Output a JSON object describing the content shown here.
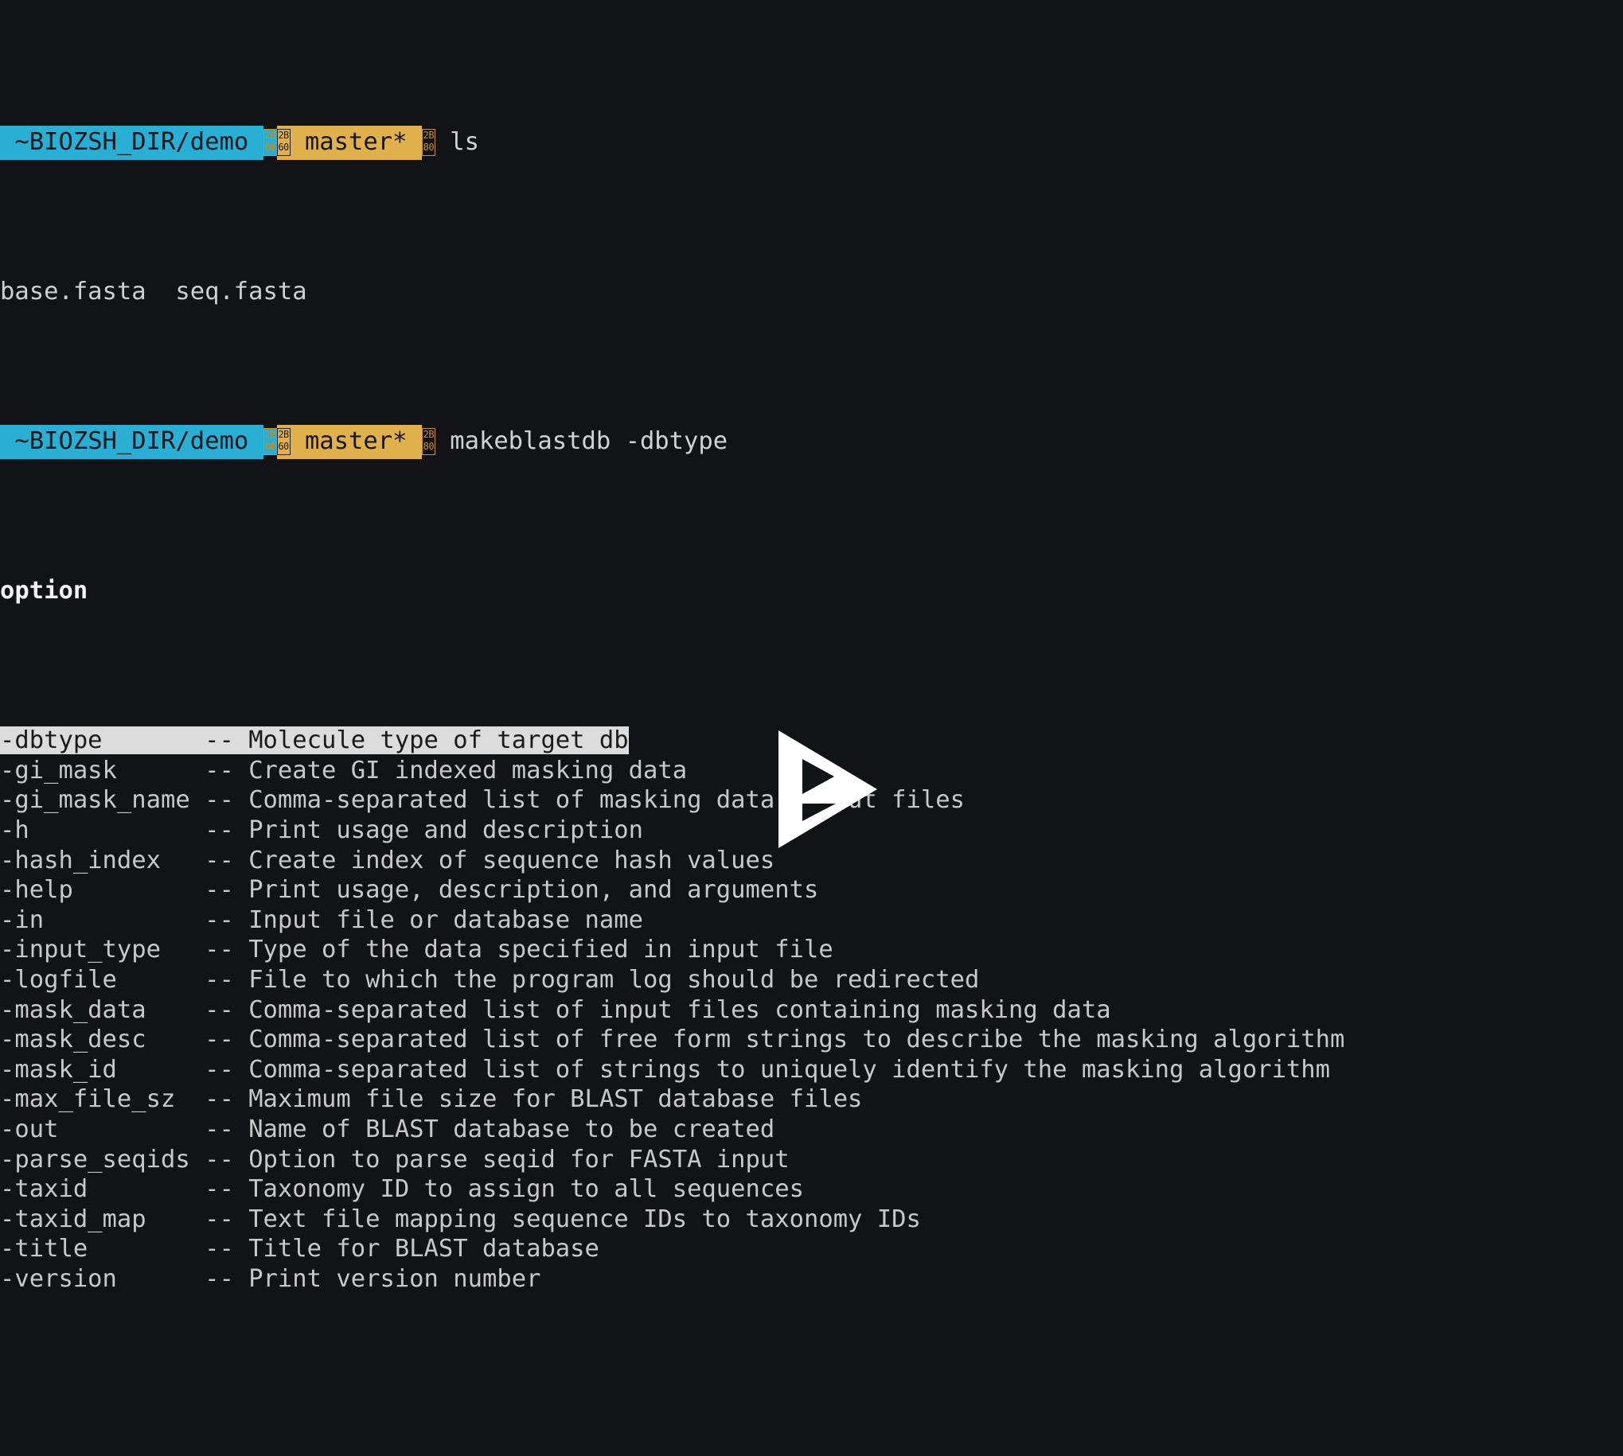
{
  "terminal": {
    "background_color": "#121317",
    "foreground_color": "#d2d2d2",
    "prompt_path_bg": "#29aed4",
    "prompt_git_bg": "#e0b04a",
    "highlight_bg": "#dcdcdc",
    "highlight_fg": "#1a1a1a"
  },
  "prompt": {
    "path": "~BIOZSH_DIR/demo",
    "git_branch": "master*",
    "separator_after_path": "2B80",
    "separator_branch_icon": "2B60",
    "separator_after_git": "2B80"
  },
  "session": {
    "command_1": "ls",
    "output_1": "base.fasta  seq.fasta",
    "command_2": "makeblastdb -dbtype"
  },
  "completion": {
    "header": "option",
    "selected_index": 0,
    "separator": "--",
    "options": [
      {
        "name": "-dbtype",
        "description": "Molecule type of target db"
      },
      {
        "name": "-gi_mask",
        "description": "Create GI indexed masking data"
      },
      {
        "name": "-gi_mask_name",
        "description": "Comma-separated list of masking data output files"
      },
      {
        "name": "-h",
        "description": "Print usage and description"
      },
      {
        "name": "-hash_index",
        "description": "Create index of sequence hash values"
      },
      {
        "name": "-help",
        "description": "Print usage, description, and arguments"
      },
      {
        "name": "-in",
        "description": "Input file or database name"
      },
      {
        "name": "-input_type",
        "description": "Type of the data specified in input file"
      },
      {
        "name": "-logfile",
        "description": "File to which the program log should be redirected"
      },
      {
        "name": "-mask_data",
        "description": "Comma-separated list of input files containing masking data"
      },
      {
        "name": "-mask_desc",
        "description": "Comma-separated list of free form strings to describe the masking algorithm"
      },
      {
        "name": "-mask_id",
        "description": "Comma-separated list of strings to uniquely identify the masking algorithm"
      },
      {
        "name": "-max_file_sz",
        "description": "Maximum file size for BLAST database files"
      },
      {
        "name": "-out",
        "description": "Name of BLAST database to be created"
      },
      {
        "name": "-parse_seqids",
        "description": "Option to parse seqid for FASTA input"
      },
      {
        "name": "-taxid",
        "description": "Taxonomy ID to assign to all sequences"
      },
      {
        "name": "-taxid_map",
        "description": "Text file mapping sequence IDs to taxonomy IDs"
      },
      {
        "name": "-title",
        "description": "Title for BLAST database"
      },
      {
        "name": "-version",
        "description": "Print version number"
      }
    ]
  },
  "overlay": {
    "play_button_label": "play",
    "play_button_color": "#ffffff"
  }
}
